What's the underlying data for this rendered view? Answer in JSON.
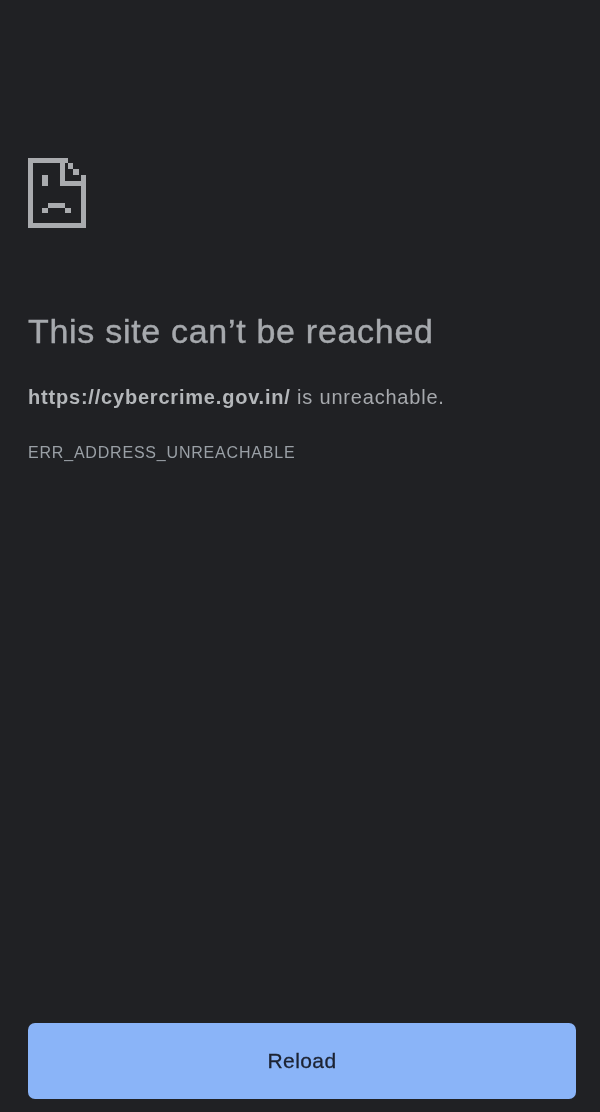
{
  "error_page": {
    "title": "This site can’t be reached",
    "message": "**https://cybercrime.gov.in/** is unreachable.",
    "error_code": "ERR_ADDRESS_UNREACHABLE"
  },
  "reload_button": {
    "label": "Reload"
  }
}
